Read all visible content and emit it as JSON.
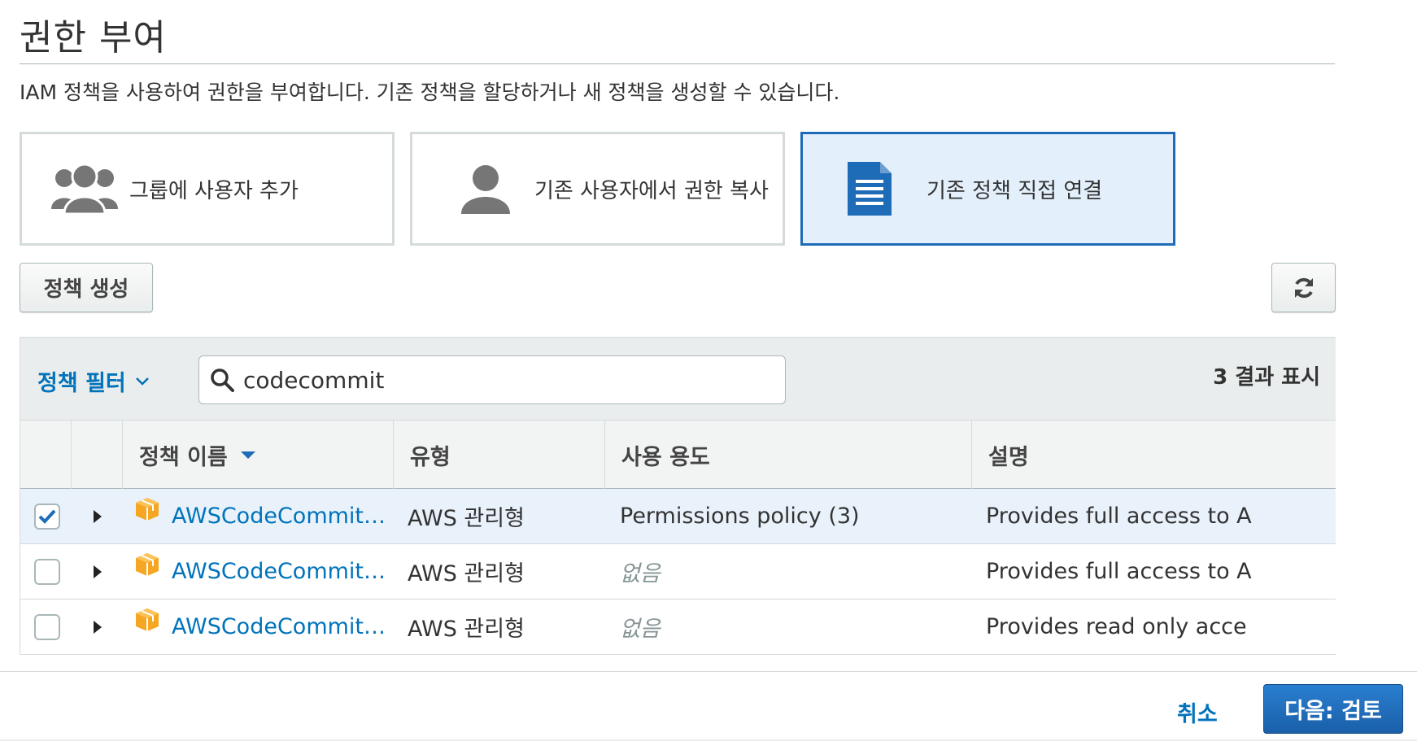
{
  "page": {
    "title": "권한 부여",
    "subtitle": "IAM 정책을 사용하여 권한을 부여합니다. 기존 정책을 할당하거나 새 정책을 생성할 수 있습니다."
  },
  "options": [
    {
      "label": "그룹에 사용자 추가",
      "icon": "users-group-icon",
      "selected": false
    },
    {
      "label": "기존 사용자에서 권한 복사",
      "icon": "user-icon",
      "selected": false
    },
    {
      "label": "기존 정책 직접 연결",
      "icon": "document-icon",
      "selected": true
    }
  ],
  "toolbar": {
    "create_policy_label": "정책 생성",
    "refresh_icon": "refresh-icon"
  },
  "filter": {
    "label": "정책 필터",
    "search_value": "codecommit",
    "results_text": "3 결과 표시"
  },
  "table": {
    "columns": [
      "정책 이름",
      "유형",
      "사용 용도",
      "설명"
    ],
    "rows": [
      {
        "name": "AWSCodeCommitF…",
        "type": "AWS 관리형",
        "usage": "Permissions policy (3)",
        "usage_none": false,
        "description": "Provides full access to A",
        "checked": true
      },
      {
        "name": "AWSCodeCommitP…",
        "type": "AWS 관리형",
        "usage": "없음",
        "usage_none": true,
        "description": "Provides full access to A",
        "checked": false
      },
      {
        "name": "AWSCodeCommitR…",
        "type": "AWS 관리형",
        "usage": "없음",
        "usage_none": true,
        "description": "Provides read only acce",
        "checked": false
      }
    ]
  },
  "footer": {
    "cancel_label": "취소",
    "next_label": "다음: 검토"
  },
  "colors": {
    "accent": "#0073bb",
    "selected_border": "#1e6bb8",
    "primary_button": "#1a5fa8",
    "policy_icon": "#f5a623"
  }
}
